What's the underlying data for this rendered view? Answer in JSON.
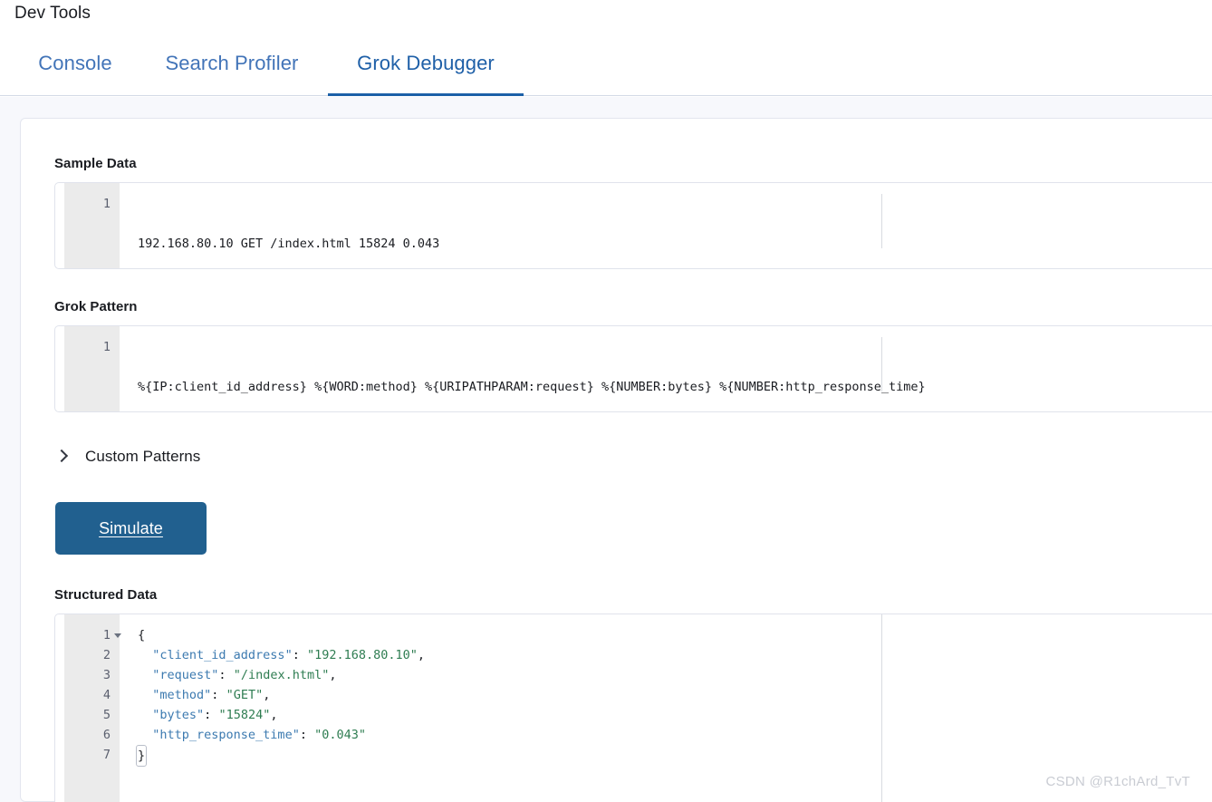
{
  "app": {
    "title": "Dev Tools"
  },
  "tabs": [
    {
      "id": "console",
      "label": "Console",
      "active": false
    },
    {
      "id": "search-profiler",
      "label": "Search Profiler",
      "active": false
    },
    {
      "id": "grok-debugger",
      "label": "Grok Debugger",
      "active": true
    }
  ],
  "sections": {
    "sample_data": {
      "label": "Sample Data",
      "line_numbers": [
        "1"
      ],
      "value": "192.168.80.10 GET /index.html 15824 0.043"
    },
    "grok_pattern": {
      "label": "Grok Pattern",
      "line_numbers": [
        "1"
      ],
      "value": "%{IP:client_id_address} %{WORD:method} %{URIPATHPARAM:request} %{NUMBER:bytes} %{NUMBER:http_response_time}"
    },
    "custom_patterns": {
      "label": "Custom Patterns",
      "expanded": false,
      "chevron_icon": "chevron-right-icon"
    },
    "simulate": {
      "label": "Simulate"
    },
    "structured_data": {
      "label": "Structured Data",
      "line_numbers": [
        "1",
        "2",
        "3",
        "4",
        "5",
        "6",
        "7"
      ],
      "lines": [
        {
          "n": "1",
          "open_brace": "{"
        },
        {
          "n": "2",
          "key": "\"client_id_address\"",
          "sep": ": ",
          "value": "\"192.168.80.10\"",
          "comma": ","
        },
        {
          "n": "3",
          "key": "\"request\"",
          "sep": ": ",
          "value": "\"/index.html\"",
          "comma": ","
        },
        {
          "n": "4",
          "key": "\"method\"",
          "sep": ": ",
          "value": "\"GET\"",
          "comma": ","
        },
        {
          "n": "5",
          "key": "\"bytes\"",
          "sep": ": ",
          "value": "\"15824\"",
          "comma": ","
        },
        {
          "n": "6",
          "key": "\"http_response_time\"",
          "sep": ": ",
          "value": "\"0.043\"",
          "comma": ""
        },
        {
          "n": "7",
          "close_brace": "}"
        }
      ],
      "parsed": {
        "client_id_address": "192.168.80.10",
        "request": "/index.html",
        "method": "GET",
        "bytes": "15824",
        "http_response_time": "0.043"
      }
    }
  },
  "watermark": {
    "text": "CSDN @R1chArd_TvT"
  },
  "colors": {
    "accent_blue": "#1c60a8",
    "tab_text": "#3b6fb5",
    "button_bg": "#21608f",
    "json_key": "#3c7ab0",
    "json_string": "#2f7d52",
    "gutter_bg": "#ebebeb",
    "content_bg": "#f7f8fc"
  }
}
